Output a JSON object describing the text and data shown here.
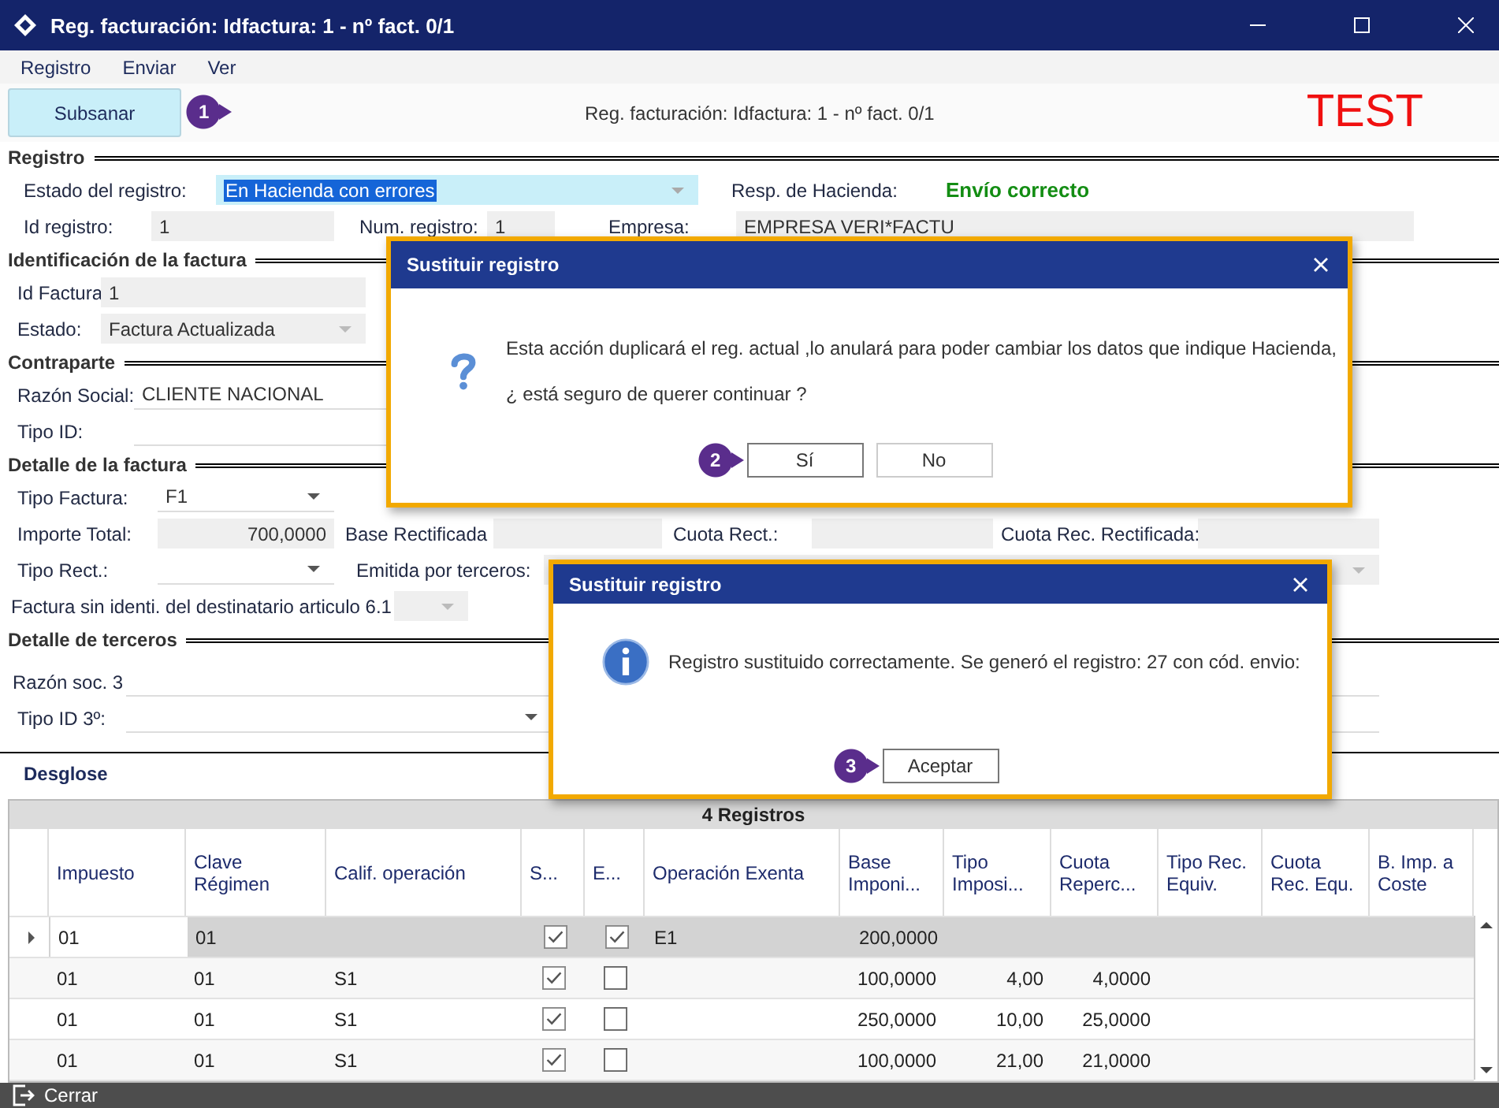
{
  "window": {
    "title": "Reg. facturación: Idfactura: 1 - nº fact. 0/1"
  },
  "menu": [
    {
      "label": "Registro"
    },
    {
      "label": "Enviar"
    },
    {
      "label": "Ver"
    }
  ],
  "toolbar": {
    "button": "Subsanar",
    "step": "1",
    "caption": "Reg. facturación: Idfactura: 1 - nº fact. 0/1",
    "badge": "TEST"
  },
  "registro": {
    "title": "Registro",
    "estado_label": "Estado del registro:",
    "estado_value": "En Hacienda con errores",
    "resp_label": "Resp. de Hacienda:",
    "resp_value": "Envío correcto",
    "id_label": "Id registro:",
    "id_value": "1",
    "num_label": "Num. registro:",
    "num_value": "1",
    "empresa_label": "Empresa:",
    "empresa_value": "EMPRESA VERI*FACTU"
  },
  "identificacion": {
    "title": "Identificación de la factura",
    "id_label": "Id Factura",
    "id_value": "1",
    "estado_label": "Estado:",
    "estado_value": "Factura Actualizada"
  },
  "contraparte": {
    "title": "Contraparte",
    "razon_label": "Razón Social:",
    "razon_value": "CLIENTE NACIONAL",
    "tipo_label": "Tipo ID:"
  },
  "detalle": {
    "title": "Detalle de la factura",
    "tipo_label": "Tipo Factura:",
    "tipo_value": "F1",
    "importe_label": "Importe Total:",
    "importe_value": "700,0000",
    "base_label": "Base Rectificada",
    "cuota_label": "Cuota Rect.:",
    "cuota_rec_label": "Cuota Rec. Rectificada:",
    "tipo_rect_label": "Tipo Rect.:",
    "emitida_label": "Emitida por terceros:",
    "sin_ident_label": "Factura sin identi. del destinatario articulo 6.1"
  },
  "terceros": {
    "title": "Detalle de terceros",
    "razon_label": "Razón soc. 3",
    "tipo_label": "Tipo ID 3º:"
  },
  "desglose": {
    "title": "Desglose",
    "count": "4 Registros",
    "columns": [
      {
        "label": "Impuesto"
      },
      {
        "label": "Clave Régimen"
      },
      {
        "label": "Calif. operación"
      },
      {
        "label": "S..."
      },
      {
        "label": "E..."
      },
      {
        "label": "Operación Exenta"
      },
      {
        "label": "Base Imponi..."
      },
      {
        "label": "Tipo Imposi..."
      },
      {
        "label": "Cuota Reperc..."
      },
      {
        "label": "Tipo Rec. Equiv."
      },
      {
        "label": "Cuota Rec. Equ."
      },
      {
        "label": "B. Imp. a Coste"
      }
    ],
    "rows": [
      {
        "selected": true,
        "cells": [
          {
            "kind": "text",
            "text": "01"
          },
          {
            "kind": "text",
            "text": "01"
          },
          {
            "kind": "empty"
          },
          {
            "kind": "check",
            "checked": true
          },
          {
            "kind": "check",
            "checked": true
          },
          {
            "kind": "text",
            "text": "E1"
          },
          {
            "kind": "number",
            "text": "200,0000"
          }
        ]
      },
      {
        "selected": false,
        "cells": [
          {
            "kind": "text",
            "text": "01"
          },
          {
            "kind": "text",
            "text": "01"
          },
          {
            "kind": "text",
            "text": "S1"
          },
          {
            "kind": "check",
            "checked": true
          },
          {
            "kind": "check",
            "checked": false
          },
          {
            "kind": "empty"
          },
          {
            "kind": "number",
            "text": "100,0000"
          },
          {
            "kind": "number",
            "text": "4,00"
          },
          {
            "kind": "number",
            "text": "4,0000"
          }
        ]
      },
      {
        "selected": false,
        "cells": [
          {
            "kind": "text",
            "text": "01"
          },
          {
            "kind": "text",
            "text": "01"
          },
          {
            "kind": "text",
            "text": "S1"
          },
          {
            "kind": "check",
            "checked": true
          },
          {
            "kind": "check",
            "checked": false
          },
          {
            "kind": "empty"
          },
          {
            "kind": "number",
            "text": "250,0000"
          },
          {
            "kind": "number",
            "text": "10,00"
          },
          {
            "kind": "number",
            "text": "25,0000"
          }
        ]
      },
      {
        "selected": false,
        "cells": [
          {
            "kind": "text",
            "text": "01"
          },
          {
            "kind": "text",
            "text": "01"
          },
          {
            "kind": "text",
            "text": "S1"
          },
          {
            "kind": "check",
            "checked": true
          },
          {
            "kind": "check",
            "checked": false
          },
          {
            "kind": "empty"
          },
          {
            "kind": "number",
            "text": "100,0000"
          },
          {
            "kind": "number",
            "text": "21,00"
          },
          {
            "kind": "number",
            "text": "21,0000"
          }
        ]
      }
    ]
  },
  "footer": {
    "close": "Cerrar"
  },
  "dialogs": [
    {
      "kind": "question",
      "title": "Sustituir registro",
      "lines": [
        "Esta acción duplicará el reg. actual ,lo anulará para poder cambiar los datos que indique Hacienda,",
        "¿ está seguro de querer continuar ?"
      ],
      "buttons": [
        {
          "label": "Sí",
          "default": true,
          "step": "2"
        },
        {
          "label": "No",
          "default": false
        }
      ]
    },
    {
      "kind": "info",
      "title": "Sustituir registro",
      "lines": [
        "Registro sustituido correctamente. Se generó el registro: 27 con cód. envio:"
      ],
      "buttons": [
        {
          "label": "Aceptar",
          "default": true,
          "step": "3"
        }
      ]
    }
  ]
}
